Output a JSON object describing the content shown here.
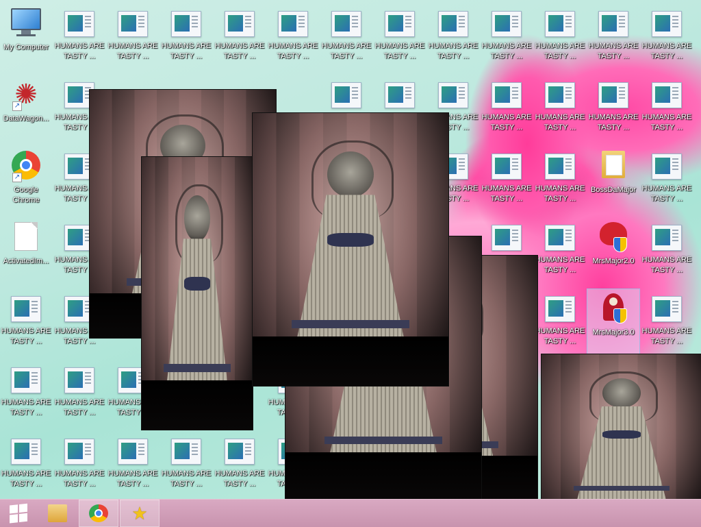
{
  "desktop": {
    "my_computer": "My Computer",
    "datawagon": "DataWagon...",
    "chrome": "Google Chrome",
    "activated": "ActivatedIm...",
    "humans": "HUMANS ARE TASTY ...",
    "bossdamajor": "BossDaMajor",
    "mrsmajor2": "MrsMajor2.0",
    "mrsmajor3": "MrsMajor3.0"
  },
  "icons": {
    "computer": "computer-icon",
    "datawagon": "star-logo-icon",
    "chrome": "chrome-icon",
    "file": "blank-file-icon",
    "image": "image-file-icon",
    "folder": "folder-icon",
    "ram": "red-ram-icon",
    "reaper": "reaper-icon",
    "shield": "uac-shield-icon"
  },
  "taskbar": {
    "start": "windows-logo-icon",
    "explorer": "file-explorer-icon",
    "chrome": "chrome-icon",
    "pinned": "star-icon"
  },
  "colors": {
    "taskbar": "#c893ae",
    "flower": "#ff4aa5",
    "background": "#bfe9df"
  }
}
